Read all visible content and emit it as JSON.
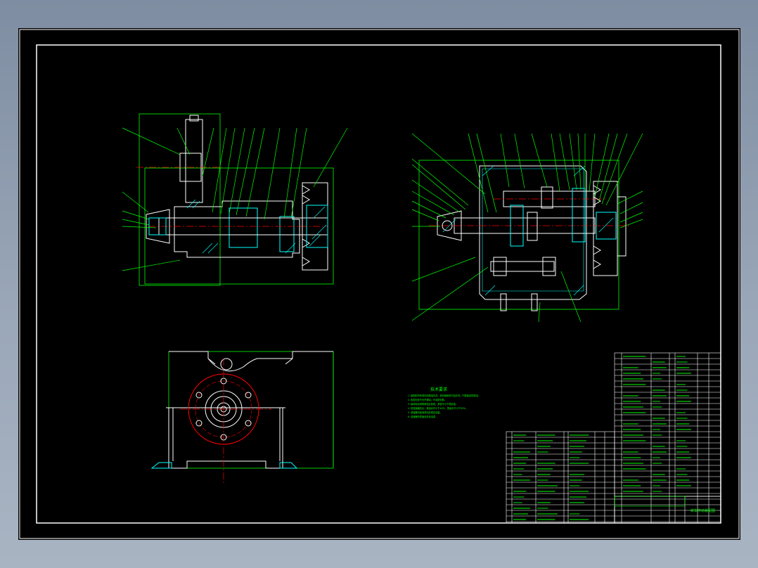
{
  "drawing": {
    "title_block_name": "绞车传动装配图",
    "tech_requirements": {
      "title": "技术要求",
      "lines": [
        "1. 装配前所有零件用煤油清洗，滚动轴承用汽油清洗，内表面涂防锈油。",
        "2. 各密封处不允许漏油，可涂密封胶。",
        "3. 齿轮啮合侧隙用铅丝检验，其值不小于规定值。",
        "4. 检查接触斑点，按齿高不小于40%，按齿长不小于50%。",
        "5. 减速器内装润滑油至规定高度。",
        "6. 减速器外表面涂灰色油漆。"
      ]
    },
    "colors": {
      "background": "#000000",
      "frame": "#ffffff",
      "outline": "#ffffff",
      "dimension": "#00ff00",
      "centerline": "#ff0000",
      "hatch": "#00ffff",
      "text": "#00ff00"
    }
  }
}
